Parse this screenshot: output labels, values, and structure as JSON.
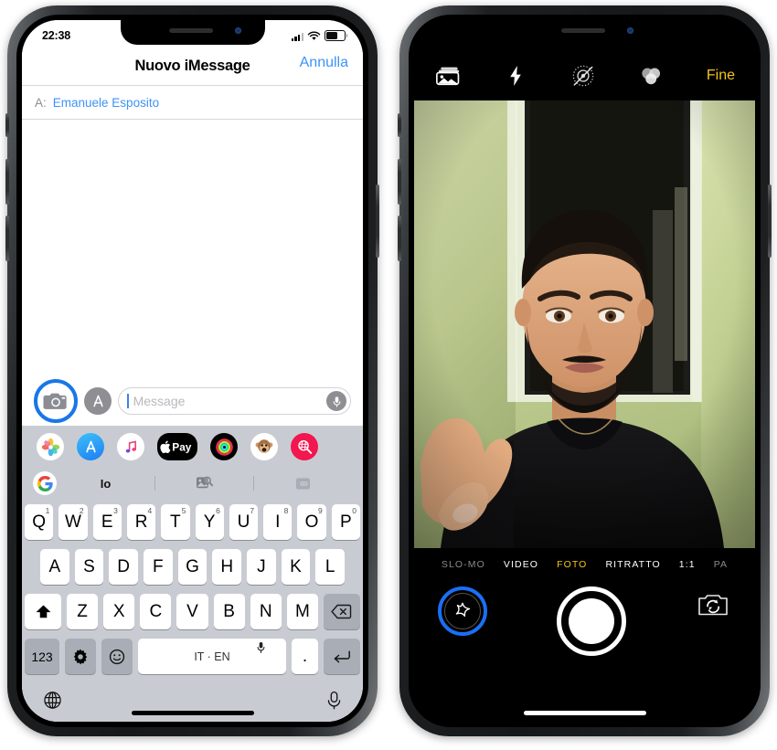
{
  "left_phone": {
    "app": "Messages",
    "statusbar": {
      "time": "22:38",
      "signal_icon": "cellular-bars-icon",
      "wifi_icon": "wifi-icon",
      "battery_icon": "battery-icon"
    },
    "navbar": {
      "title": "Nuovo iMessage",
      "cancel_label": "Annulla"
    },
    "recipient": {
      "label": "A:",
      "name": "Emanuele Esposito"
    },
    "input_bar": {
      "camera_icon": "camera-icon",
      "appstore_icon": "app-store-icon",
      "placeholder": "Message",
      "value": "",
      "mic_icon": "microphone-icon",
      "highlighted": "camera-icon",
      "highlight_color": "#1877e8"
    },
    "app_drawer": [
      {
        "name": "photos-app-icon",
        "label": "Photos"
      },
      {
        "name": "app-store-app-icon",
        "label": "App Store"
      },
      {
        "name": "music-app-icon",
        "label": "Music"
      },
      {
        "name": "apple-pay-app-icon",
        "label": "Pay"
      },
      {
        "name": "activity-app-icon",
        "label": "Activity"
      },
      {
        "name": "animoji-app-icon",
        "label": "Animoji"
      },
      {
        "name": "images-app-icon",
        "label": "#images"
      }
    ],
    "suggestion_row": {
      "google_icon": "google-g-icon",
      "items": [
        "Io",
        "",
        ""
      ],
      "icons": [
        "",
        "image-search-icon",
        "gif-search-icon"
      ]
    },
    "keyboard": {
      "row1": [
        {
          "key": "Q",
          "alt": "1"
        },
        {
          "key": "W",
          "alt": "2"
        },
        {
          "key": "E",
          "alt": "3"
        },
        {
          "key": "R",
          "alt": "4"
        },
        {
          "key": "T",
          "alt": "5"
        },
        {
          "key": "Y",
          "alt": "6"
        },
        {
          "key": "U",
          "alt": "7"
        },
        {
          "key": "I",
          "alt": "8"
        },
        {
          "key": "O",
          "alt": "9"
        },
        {
          "key": "P",
          "alt": "0"
        }
      ],
      "row2": [
        {
          "key": "A"
        },
        {
          "key": "S"
        },
        {
          "key": "D"
        },
        {
          "key": "F"
        },
        {
          "key": "G"
        },
        {
          "key": "H"
        },
        {
          "key": "J"
        },
        {
          "key": "K"
        },
        {
          "key": "L"
        }
      ],
      "row3": {
        "shift_icon": "shift-arrow-icon",
        "letters": [
          {
            "key": "Z"
          },
          {
            "key": "X"
          },
          {
            "key": "C"
          },
          {
            "key": "V"
          },
          {
            "key": "B"
          },
          {
            "key": "N"
          },
          {
            "key": "M"
          }
        ],
        "backspace_icon": "backspace-icon"
      },
      "row4": {
        "numbers_label": "123",
        "settings_icon": "gear-icon",
        "emoji_icon": "smiley-icon",
        "space_label": "IT · EN",
        "space_mic_icon": "microphone-icon",
        "period_label": ".",
        "return_icon": "return-arrow-icon"
      },
      "footer": {
        "globe_icon": "globe-icon",
        "dictation_icon": "microphone-icon"
      }
    },
    "home_indicator": "home-indicator"
  },
  "right_phone": {
    "app": "Camera",
    "statusbar": {
      "time": "",
      "hidden": true
    },
    "top_bar": {
      "gallery_icon": "photo-stack-icon",
      "flash_icon": "flash-bolt-icon",
      "livephoto_off_icon": "live-photo-off-icon",
      "filters_icon": "color-filters-icon",
      "done_label": "Fine",
      "done_color": "#f5c518"
    },
    "viewfinder": {
      "description": "Front-camera selfie of a man in a black t-shirt in front of a green wall and a doorway"
    },
    "modes": [
      {
        "label": "SLO-MO",
        "state": "dim"
      },
      {
        "label": "VIDEO",
        "state": "normal"
      },
      {
        "label": "FOTO",
        "state": "active"
      },
      {
        "label": "RITRATTO",
        "state": "normal"
      },
      {
        "label": "1:1",
        "state": "normal"
      },
      {
        "label": "PA",
        "state": "dim"
      }
    ],
    "controls": {
      "effects_icon": "effects-star-icon",
      "effects_highlighted": true,
      "highlight_color": "#1a6ff5",
      "shutter_label": "shutter-button",
      "flip_icon": "camera-flip-icon"
    },
    "home_indicator": "home-indicator"
  }
}
